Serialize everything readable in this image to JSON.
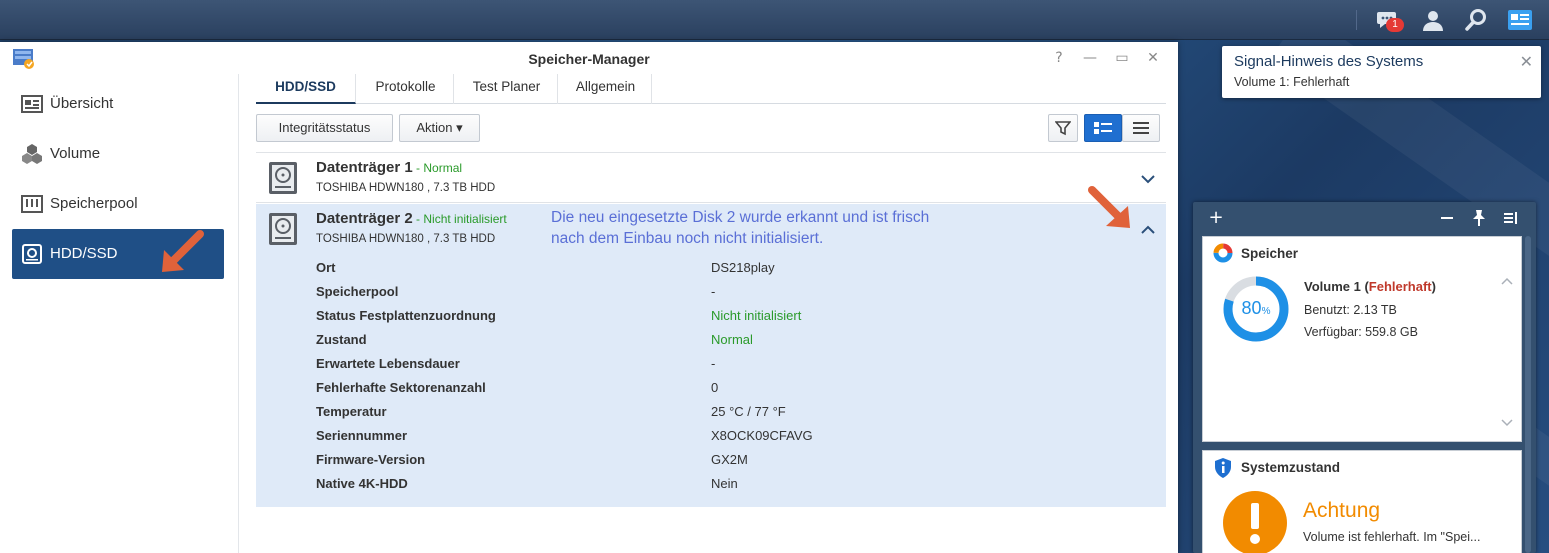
{
  "taskbar": {
    "chat_badge": "1"
  },
  "window": {
    "title": "Speicher-Manager",
    "controls": {
      "help": "?",
      "minimize": "—",
      "maximize": "▭",
      "close": "✕"
    }
  },
  "sidebar": {
    "items": [
      {
        "label": "Übersicht",
        "icon": "overview-icon"
      },
      {
        "label": "Volume",
        "icon": "cubes-icon"
      },
      {
        "label": "Speicherpool",
        "icon": "storage-pool-icon"
      },
      {
        "label": "HDD/SSD",
        "icon": "hdd-icon"
      }
    ]
  },
  "tabs": [
    "HDD/SSD",
    "Protokolle",
    "Test Planer",
    "Allgemein"
  ],
  "toolbar": {
    "integrity": "Integritätsstatus",
    "action": "Aktion ▾"
  },
  "disks": [
    {
      "name": "Datenträger 1",
      "status": " - Normal",
      "model": "TOSHIBA HDWN180 , 7.3 TB HDD"
    },
    {
      "name": "Datenträger 2",
      "status": " - Nicht initialisiert",
      "model": "TOSHIBA HDWN180 , 7.3 TB HDD"
    }
  ],
  "annotation": "Die neu eingesetzte Disk 2 wurde erkannt und ist frisch nach dem Einbau noch nicht initialisiert.",
  "details": [
    {
      "label": "Ort",
      "value": "DS218play"
    },
    {
      "label": "Speicherpool",
      "value": "-"
    },
    {
      "label": "Status Festplattenzuordnung",
      "value": "Nicht initialisiert"
    },
    {
      "label": "Zustand",
      "value": "Normal"
    },
    {
      "label": "Erwartete Lebensdauer",
      "value": "-"
    },
    {
      "label": "Fehlerhafte Sektorenanzahl",
      "value": "0"
    },
    {
      "label": "Temperatur",
      "value": "25 °C / 77 °F"
    },
    {
      "label": "Seriennummer",
      "value": "X8OCK09CFAVG"
    },
    {
      "label": "Firmware-Version",
      "value": "GX2M"
    },
    {
      "label": "Native 4K-HDD",
      "value": "Nein"
    }
  ],
  "notification": {
    "title": "Signal-Hinweis des Systems",
    "body": "Volume 1: Fehlerhaft",
    "close": "✕"
  },
  "widget": {
    "add": "+",
    "storage": {
      "title": "Speicher",
      "percent": "80",
      "percent_unit": "%",
      "usage_fraction": 0.8,
      "volume_name": "Volume 1 (",
      "volume_state": "Fehlerhaft",
      "volume_close": ")",
      "used": "Benutzt: 2.13 TB",
      "free": "Verfügbar: 559.8 GB"
    },
    "health": {
      "title": "Systemzustand",
      "status": "Achtung",
      "text": "Volume ist fehlerhaft. Im \"Spei..."
    }
  },
  "colors": {
    "accent": "#1f4f86",
    "ok_green": "#2a9a2a",
    "error_red": "#c0392b",
    "warning_orange": "#f28b00",
    "donut_blue": "#1e90e6"
  }
}
